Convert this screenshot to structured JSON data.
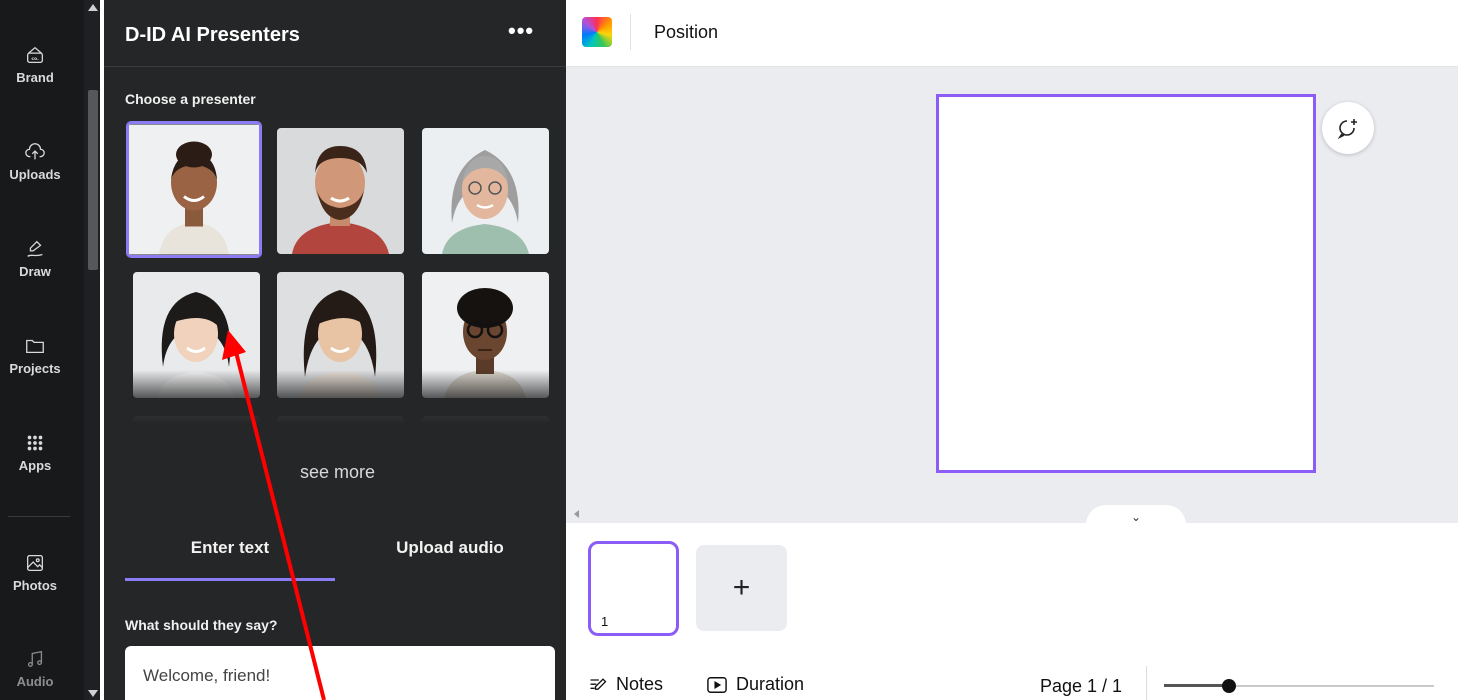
{
  "rail": {
    "items": [
      {
        "label": "Brand",
        "icon": "brand-kit-icon"
      },
      {
        "label": "Uploads",
        "icon": "cloud-upload-icon"
      },
      {
        "label": "Draw",
        "icon": "pen-scribble-icon"
      },
      {
        "label": "Projects",
        "icon": "folder-icon"
      },
      {
        "label": "Apps",
        "icon": "apps-grid-icon"
      },
      {
        "label": "Photos",
        "icon": "image-icon"
      },
      {
        "label": "Audio",
        "icon": "music-note-icon"
      }
    ]
  },
  "panel": {
    "title": "D-ID AI Presenters",
    "more_label": "•••",
    "choose_label": "Choose a presenter",
    "see_more": "see more",
    "tabs": [
      {
        "label": "Enter text",
        "active": true
      },
      {
        "label": "Upload audio",
        "active": false
      }
    ],
    "say_label": "What should they say?",
    "say_value": "Welcome, friend!",
    "presenters": [
      {
        "name": "presenter-1",
        "selected": true
      },
      {
        "name": "presenter-2",
        "selected": false
      },
      {
        "name": "presenter-3",
        "selected": false
      },
      {
        "name": "presenter-4",
        "selected": false
      },
      {
        "name": "presenter-5",
        "selected": false
      },
      {
        "name": "presenter-6",
        "selected": false
      },
      {
        "name": "presenter-7",
        "selected": false
      },
      {
        "name": "presenter-8",
        "selected": false
      },
      {
        "name": "presenter-9",
        "selected": false
      }
    ]
  },
  "toolbar": {
    "position_label": "Position"
  },
  "pages": {
    "current_page_number": "1",
    "add_label": "+",
    "toggle_label": "⌄"
  },
  "bottombar": {
    "notes_label": "Notes",
    "duration_label": "Duration",
    "pager_label": "Page 1 / 1",
    "zoom_level": 0.24
  },
  "colors": {
    "accent": "#8b5cf6",
    "panel_bg": "#252627",
    "rail_bg": "#18191b",
    "annotation": "#ff0000"
  }
}
